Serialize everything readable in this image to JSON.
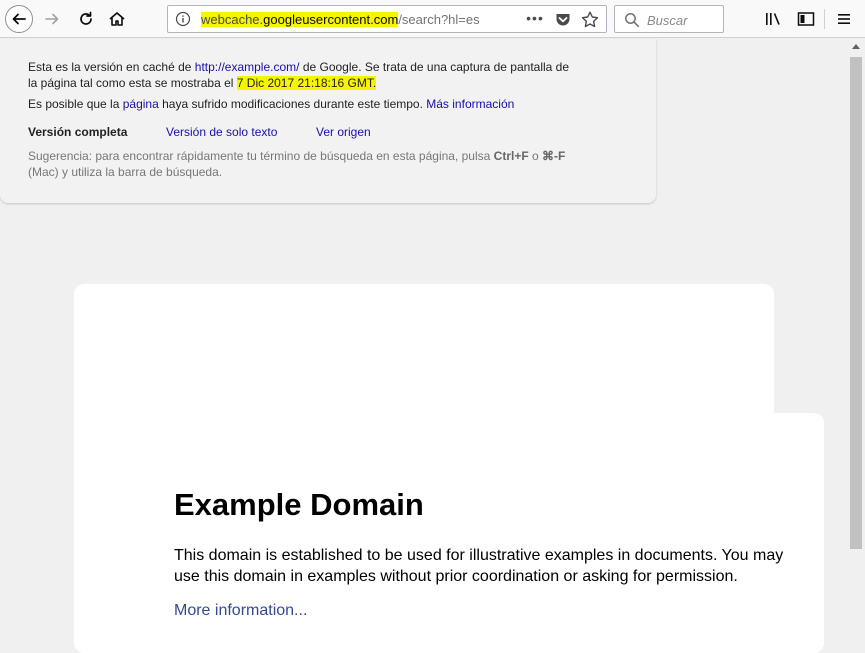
{
  "toolbar": {
    "url_host_prefix": "webcache.",
    "url_host_main": "googleusercontent.com",
    "url_path": "/search?hl=es",
    "search_placeholder": "Buscar",
    "dots_label": "•••"
  },
  "cache": {
    "line1_pre": "Esta es la versión en caché de ",
    "line1_link": "http://example.com/",
    "line1_post": " de Google. Se trata de una captura de pantalla de",
    "line2_pre": "la página tal como esta se mostraba el ",
    "line2_date": "7 Dic 2017 21:18:16 GMT.",
    "line3_pre": "Es posible que la ",
    "line3_link": "página",
    "line3_mid": " haya sufrido modificaciones durante este tiempo. ",
    "line3_more": "Más información",
    "full_version": "Versión completa",
    "text_only": "Versión de solo texto",
    "view_source": "Ver origen",
    "tip_line1_pre": "Sugerencia: para encontrar rápidamente tu término de búsqueda en esta página, pulsa ",
    "tip_ctrl_f": "Ctrl+F",
    "tip_or": " o ",
    "tip_cmd_f": "⌘-F",
    "tip_line2": "(Mac) y utiliza la barra de búsqueda."
  },
  "page": {
    "title": "Example Domain",
    "paragraph": "This domain is established to be used for illustrative examples in documents. You may use this domain in examples without prior coordination or asking for permission.",
    "more_link": "More information..."
  },
  "colors": {
    "link": "#1a0dab",
    "highlight": "#f5f500",
    "page_link": "#38488f"
  }
}
